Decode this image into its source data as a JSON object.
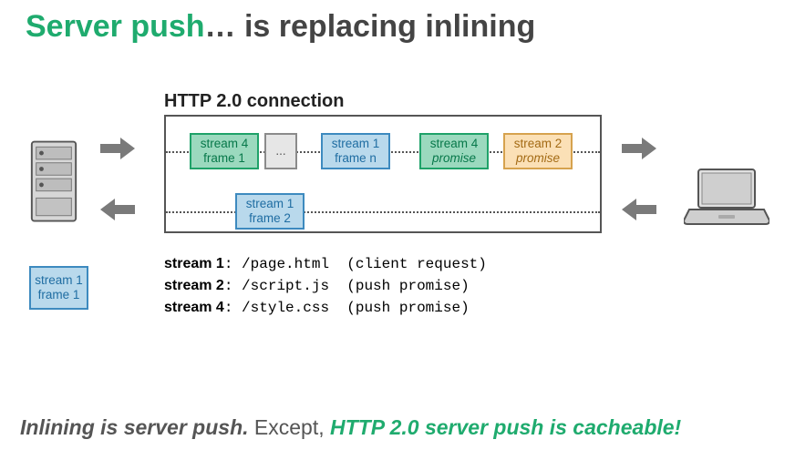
{
  "title": {
    "accent": "Server push",
    "rest": "… is replacing inlining"
  },
  "connection_label": "HTTP 2.0 connection",
  "frames": {
    "top": [
      {
        "l1": "stream 4",
        "l2": "frame 1",
        "cls": "f-green"
      },
      {
        "l1": "...",
        "l2": "",
        "cls": "f-grey"
      },
      {
        "l1": "stream 1",
        "l2": "frame n",
        "cls": "f-blue"
      },
      {
        "l1": "stream 4",
        "l2": "promise",
        "cls": "f-green",
        "em2": true
      },
      {
        "l1": "stream 2",
        "l2": "promise",
        "cls": "f-orange",
        "em2": true
      }
    ],
    "bottom": {
      "l1": "stream 1",
      "l2": "frame 2",
      "cls": "f-blue"
    },
    "server_out": {
      "l1": "stream 1",
      "l2": "frame 1",
      "cls": "f-blue"
    }
  },
  "legend": [
    {
      "label": "stream 1",
      "path": ": /page.html",
      "note": "  (client request)"
    },
    {
      "label": "stream 2",
      "path": ": /script.js",
      "note": "  (push promise)"
    },
    {
      "label": "stream 4",
      "path": ": /style.css",
      "note": "  (push promise)"
    }
  ],
  "footer": {
    "part1": "Inlining is server push.",
    "part2": " Except, ",
    "accent": "HTTP 2.0 server push is cacheable!"
  },
  "icons": {
    "server": "server-icon",
    "laptop": "laptop-icon",
    "arrow_r": "arrow-right-icon",
    "arrow_l": "arrow-left-icon"
  },
  "watermark": ""
}
